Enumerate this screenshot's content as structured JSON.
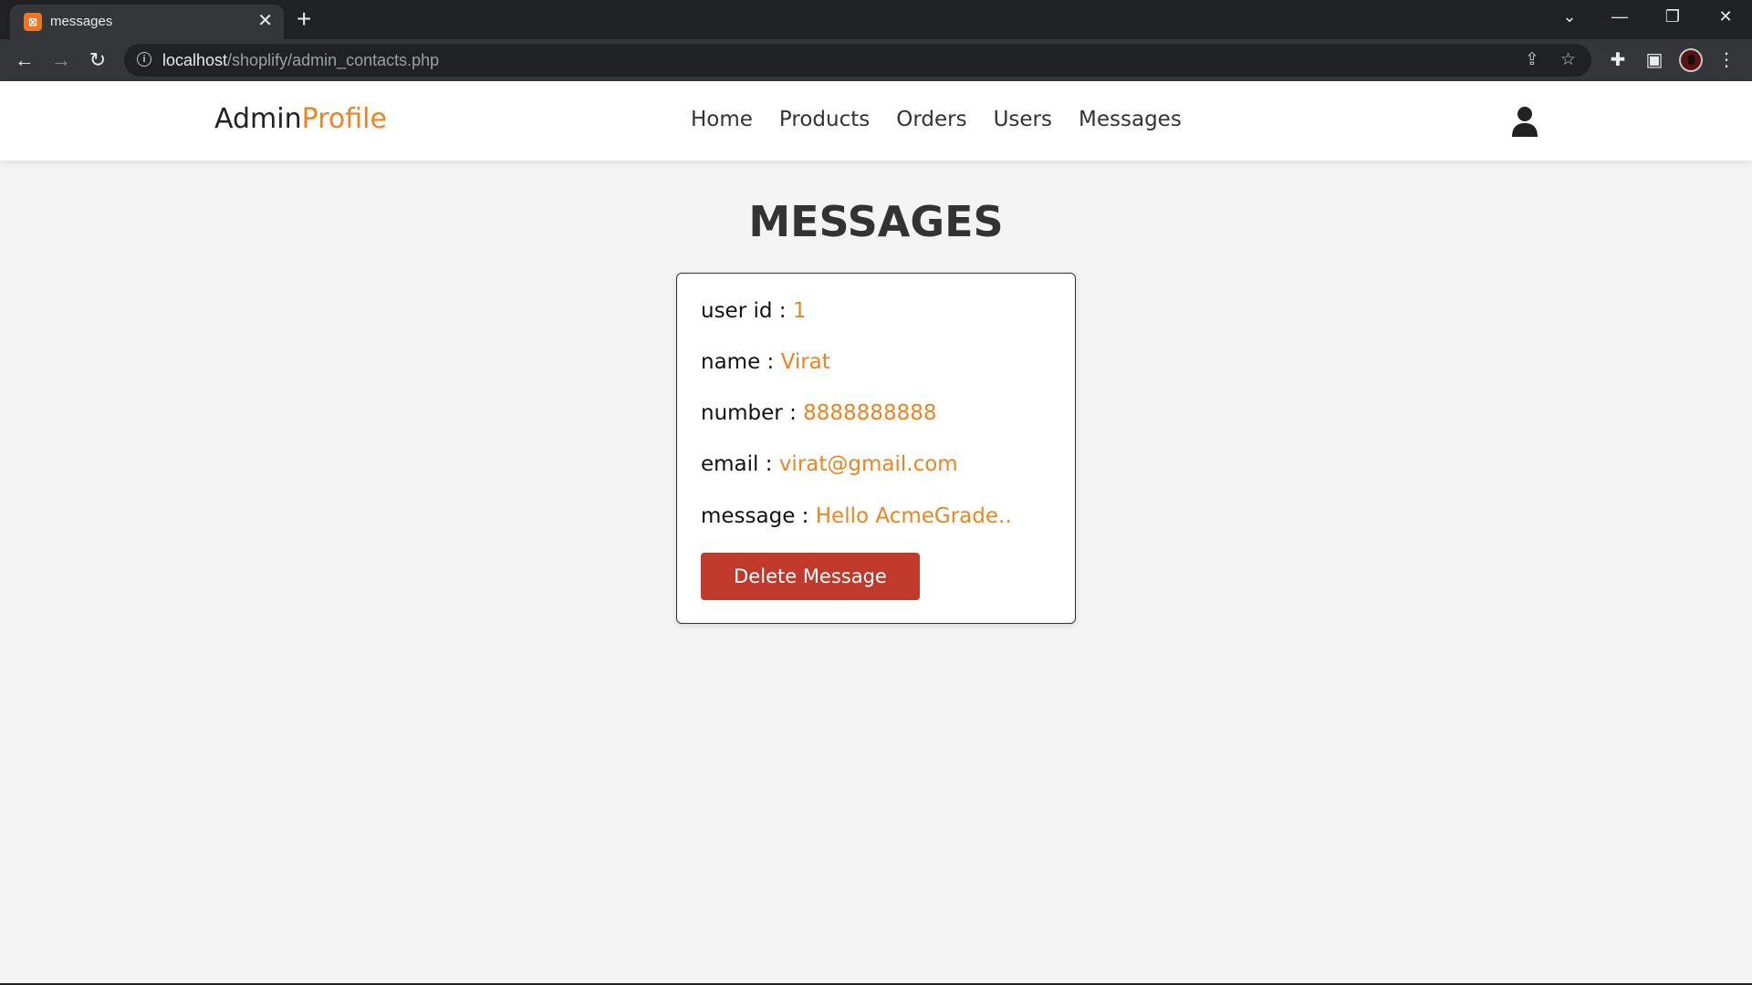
{
  "browser": {
    "tab_title": "messages",
    "url_host": "localhost",
    "url_path": "/shoplify/admin_contacts.php"
  },
  "header": {
    "logo_main": "Admin",
    "logo_accent": "Profile",
    "nav": [
      "Home",
      "Products",
      "Orders",
      "Users",
      "Messages"
    ]
  },
  "page": {
    "title": "MESSAGES"
  },
  "message": {
    "user_id_label": "user id : ",
    "user_id": "1",
    "name_label": "name : ",
    "name": "Virat",
    "number_label": "number : ",
    "number": "8888888888",
    "email_label": "email : ",
    "email": "virat@gmail.com",
    "message_label": "message : ",
    "message": "Hello AcmeGrade..",
    "delete_label": "Delete Message"
  },
  "colors": {
    "accent": "#f0831f",
    "danger": "#c0392b",
    "background": "#f4f4f4"
  },
  "icons": {
    "favicon": "xampp-icon",
    "user": "user-icon"
  }
}
